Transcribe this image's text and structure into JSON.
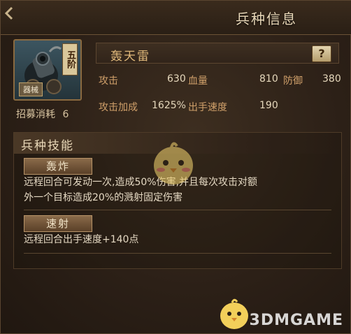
{
  "header": {
    "title": "兵种信息"
  },
  "unit": {
    "rank": "五阶",
    "type": "器械",
    "recruit_cost_label": "招募消耗",
    "recruit_cost_value": "6",
    "name": "轰天雷",
    "help": "?"
  },
  "stats": {
    "attack": {
      "label": "攻击",
      "value": "630"
    },
    "hp": {
      "label": "血量",
      "value": "810"
    },
    "defense": {
      "label": "防御",
      "value": "380"
    },
    "attack_bonus": {
      "label": "攻击加成",
      "value": "1625%"
    },
    "speed": {
      "label": "出手速度",
      "value": "190"
    }
  },
  "skills": {
    "title": "兵种技能",
    "items": [
      {
        "name": "轰炸",
        "desc_line1": "远程回合可发动一次,造成50%伤害,并且每次攻击对额",
        "desc_line2": "外一个目标造成20%的溅射固定伤害"
      },
      {
        "name": "速射",
        "desc_line1": "远程回合出手速度+140点"
      }
    ]
  },
  "watermark": "3DMGAME",
  "colors": {
    "label": "#d0a06a",
    "value": "#e6d8bc",
    "accent": "#e0b87a",
    "background": "#2c2017"
  }
}
